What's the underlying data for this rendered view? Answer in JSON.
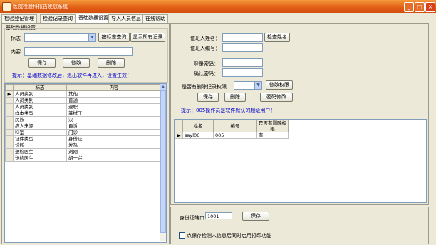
{
  "window": {
    "title": "医院检验科报告发放系统",
    "icon": "app-icon",
    "min_icon": "minimize-icon",
    "max_icon": "maximize-icon",
    "close_icon": "close-icon"
  },
  "tabs": [
    "检验登记管理",
    "检验记录查询",
    "基础数据设置",
    "导入人员信息",
    "在线帮助"
  ],
  "active_tab": 2,
  "base": {
    "group_title": "基础数据设置",
    "tag_label": "标志",
    "query_button": "按标志查询",
    "show_all_button": "显示所有记录",
    "content_label": "内容",
    "save_button": "保存",
    "edit_button": "修改",
    "delete_button": "删除",
    "hint": "提示：基础数据修改后，退出软件再进入，设置生效！",
    "table": {
      "headers": [
        "标志",
        "内容"
      ],
      "rows": [
        [
          "人员类别",
          "其他"
        ],
        [
          "人员类别",
          "普通"
        ],
        [
          "人员类别",
          "退职"
        ],
        [
          "样本类型",
          "粪拭子"
        ],
        [
          "民族",
          "汉"
        ],
        [
          "病人来源",
          "自诉"
        ],
        [
          "科室",
          "门诊"
        ],
        [
          "证件类型",
          "身份证"
        ],
        [
          "诊断",
          "发热"
        ],
        [
          "送检医生",
          "刘刚"
        ],
        [
          "送检医生",
          "胡一兴"
        ]
      ]
    }
  },
  "operator": {
    "name_label": "值班人姓名：",
    "name_value": "",
    "id_label": "值班人编号：",
    "id_value": "",
    "check_name_button": "检查姓名",
    "login_pwd_label": "登录密码：",
    "login_pwd_value": "",
    "confirm_pwd_label": "确认密码：",
    "confirm_pwd_value": "",
    "admin_label": "是否有删除记录权限",
    "admin_value": "",
    "modify_perm_button": "修改权限",
    "save_button": "保存",
    "delete_button": "删除",
    "pwd_edit_button": "密码修改",
    "hint": "提示：005操作员是软件默认的超级用户！",
    "table": {
      "headers": [
        "姓名",
        "编号",
        "是否有删除权限"
      ],
      "rows": [
        [
          "sayl06",
          "005",
          "有"
        ]
      ]
    }
  },
  "bottom": {
    "port_label": "身份证端口",
    "port_value": "1001",
    "save_button": "保存",
    "checkbox_label": "点保存检测人信息后同时启用打印功能",
    "checkbox_checked": false
  }
}
